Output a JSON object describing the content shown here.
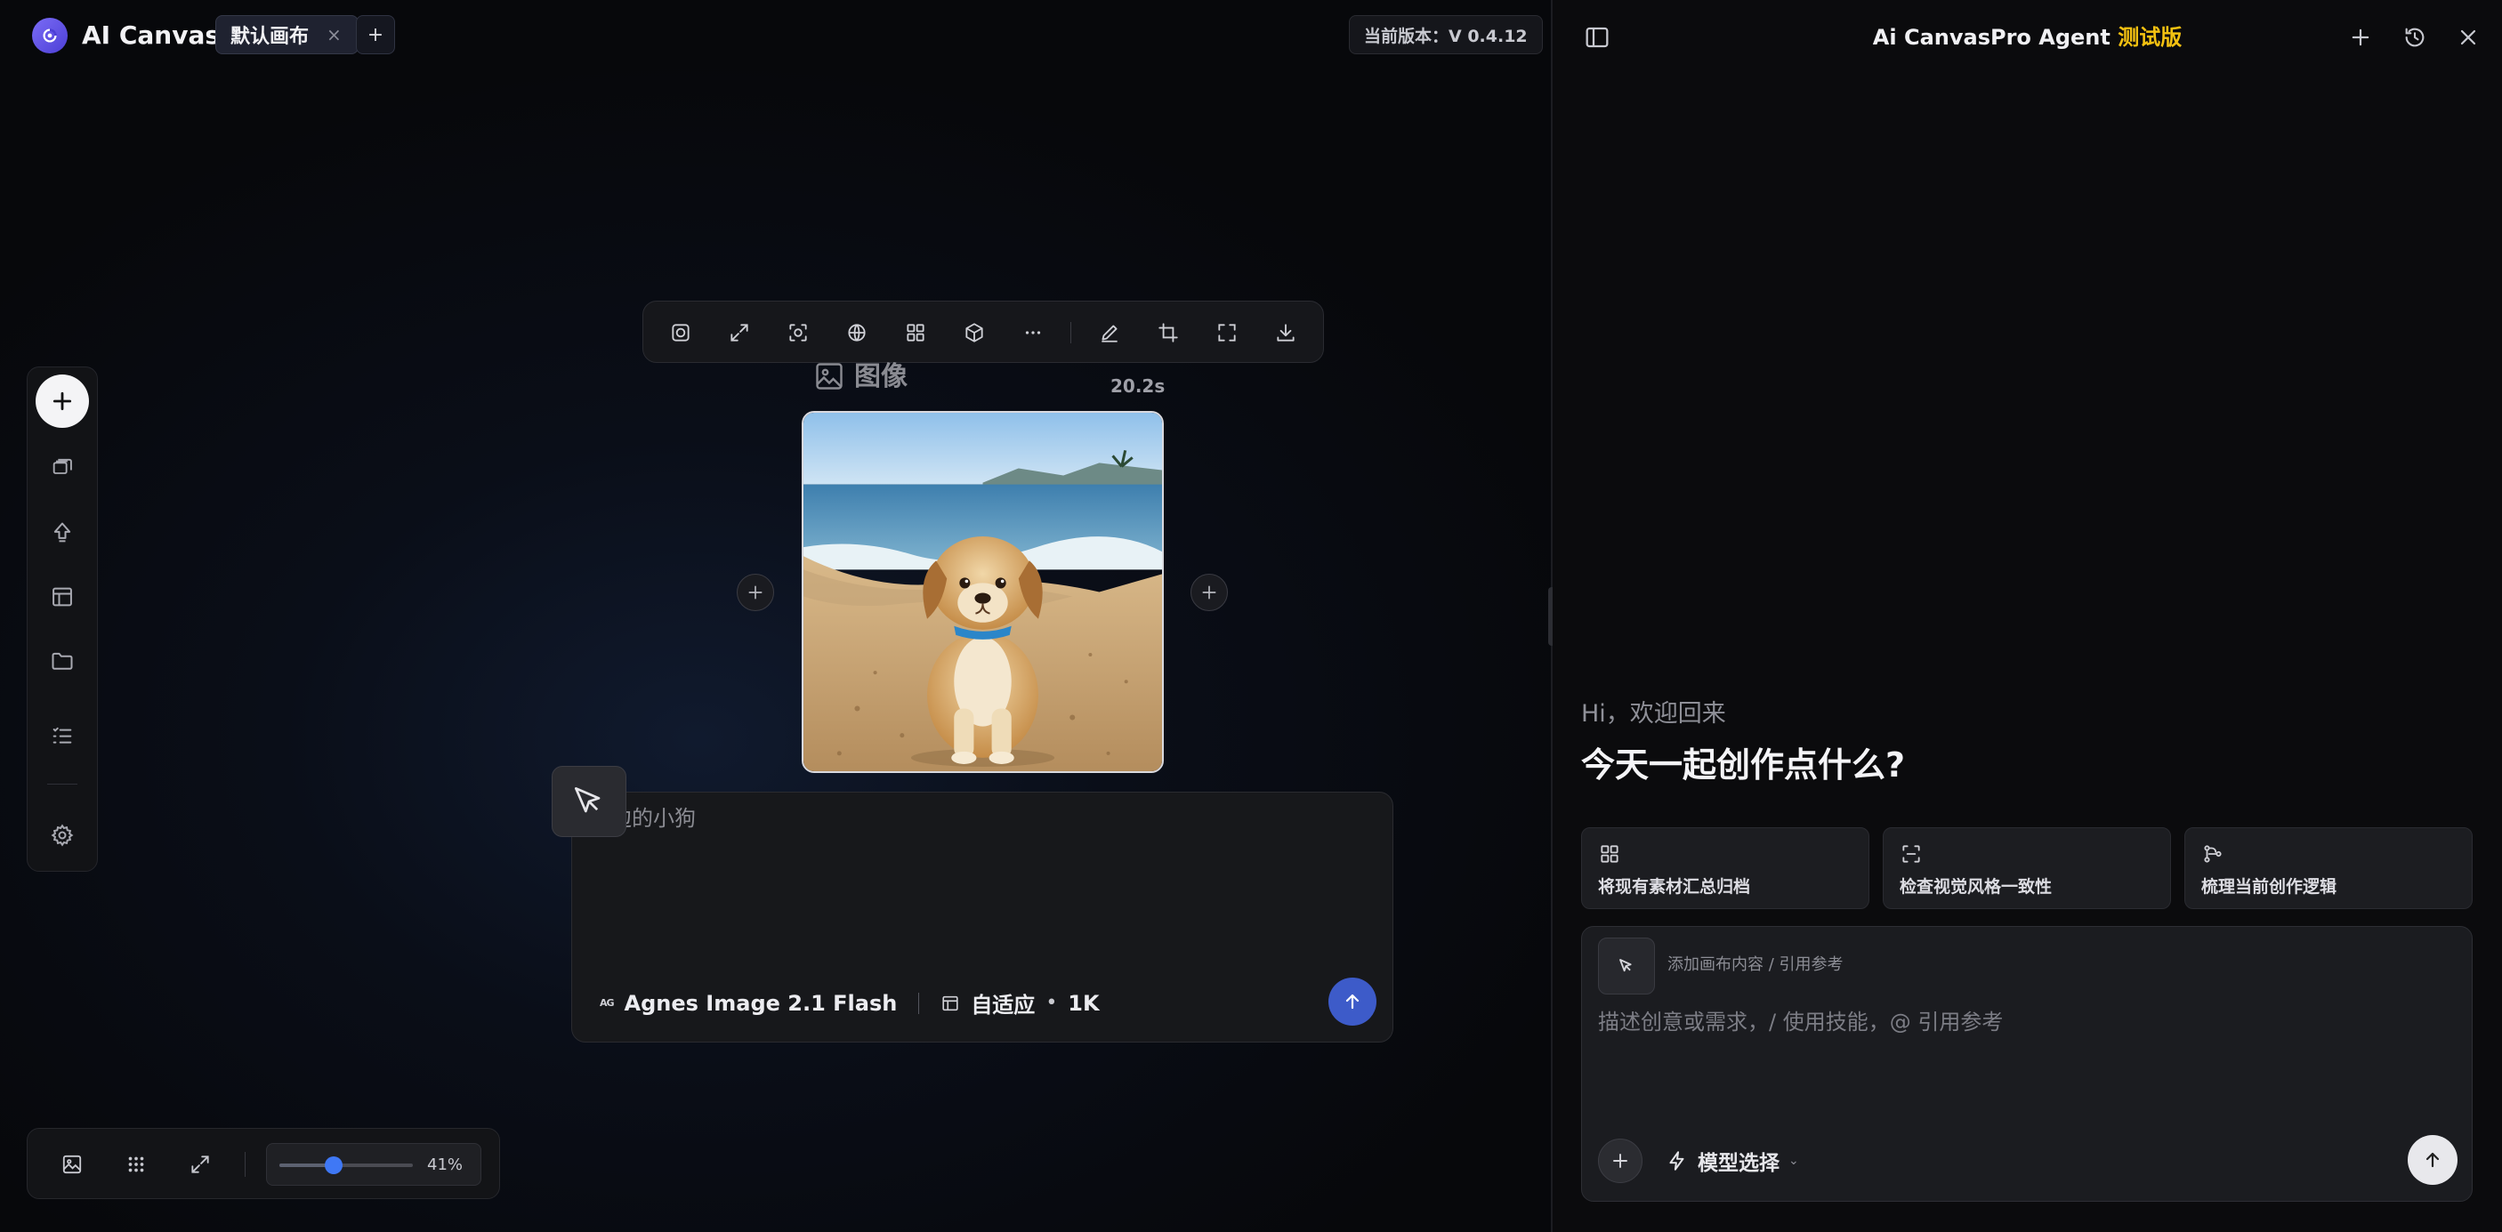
{
  "app": {
    "title": "AI Canvas",
    "tab_label": "默认画布",
    "tab_close": "×",
    "tab_add": "+",
    "version": "当前版本：V 0.4.12"
  },
  "toolbar_left": {
    "items": [
      "add-icon",
      "layers-icon",
      "upload-icon",
      "layout-icon",
      "folder-icon",
      "list-icon",
      "gear-icon"
    ]
  },
  "image_toolbar": {
    "items": [
      "remove-background-icon",
      "expand-icon",
      "focus-icon",
      "globe-icon",
      "grid-icon",
      "cube-icon",
      "more-icon",
      "pen-icon",
      "crop-icon",
      "fullscreen-icon",
      "download-icon"
    ]
  },
  "node": {
    "label": "图像",
    "time": "20.2s"
  },
  "prompt": {
    "text": "海边的小狗",
    "model_logo": "AG",
    "model_name": "Agnes Image 2.1 Flash",
    "ratio": "自适应",
    "dot": "•",
    "resolution": "1K"
  },
  "bottom_bar": {
    "zoom_label": "41%",
    "zoom_fraction": 0.41
  },
  "panel": {
    "title": "Ai CanvasPro Agent",
    "badge": "测试版",
    "greeting": "Hi，欢迎回来",
    "headline": "今天一起创作点什么?",
    "quick_actions": [
      {
        "label": "将现有素材汇总归档",
        "icon": "grid-icon"
      },
      {
        "label": "检查视觉风格一致性",
        "icon": "scan-icon"
      },
      {
        "label": "梳理当前创作逻辑",
        "icon": "flow-icon"
      }
    ],
    "ref_label": "添加画布内容 / 引用参考",
    "placeholder": "描述创意或需求，/ 使用技能，@ 引用参考",
    "model_select": "模型选择",
    "caret": "⌄"
  },
  "colors": {
    "accent": "#3d5bc9",
    "badge": "#f5c211",
    "zoom_thumb": "#3f78f5"
  }
}
